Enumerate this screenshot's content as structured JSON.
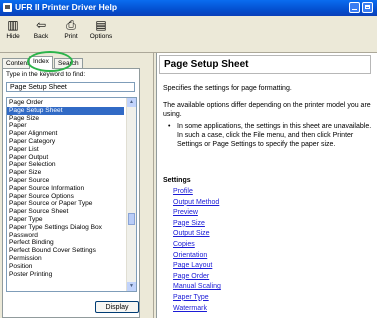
{
  "window": {
    "title": "UFR II Printer Driver Help",
    "min_icon": "minimize-icon",
    "max_icon": "maximize-icon"
  },
  "toolbar": {
    "buttons": [
      {
        "label": "Hide",
        "icon": "hide-icon",
        "glyph": "▥"
      },
      {
        "label": "Back",
        "icon": "back-icon",
        "glyph": "⇦"
      },
      {
        "label": "Print",
        "icon": "print-icon",
        "glyph": "⎙"
      },
      {
        "label": "Options",
        "icon": "options-icon",
        "glyph": "▤"
      }
    ]
  },
  "left": {
    "tabs": [
      "Contents",
      "Index",
      "Search"
    ],
    "active_tab": "Index",
    "prompt": "Type in the keyword to find:",
    "search_value": "Page Setup Sheet",
    "items": [
      "Page Order",
      "Page Setup Sheet",
      "Page Size",
      "Paper",
      "Paper Alignment",
      "Paper Category",
      "Paper List",
      "Paper Output",
      "Paper Selection",
      "Paper Size",
      "Paper Source",
      "Paper Source Information",
      "Paper Source Options",
      "Paper Source or Paper Type",
      "Paper Source Sheet",
      "Paper Type",
      "Paper Type Settings Dialog Box",
      "Password",
      "Perfect Binding",
      "Perfect Bound Cover Settings",
      "Permission",
      "Position",
      "Poster Printing"
    ],
    "selected_item": "Page Setup Sheet",
    "display_button": "Display"
  },
  "content": {
    "heading": "Page Setup Sheet",
    "para1": "Specifies the settings for page formatting.",
    "para2": "The available options differ depending on the printer model you are using.",
    "bullet": "•",
    "note": "In some applications, the settings in this sheet are unavailable. In such a case, click the File menu, and then click Printer Settings or Page Settings to specify the paper size.",
    "settings_title": "Settings",
    "links": [
      "Profile",
      "Output Method",
      "Preview",
      "Page Size",
      "Output Size",
      "Copies",
      "Orientation",
      "Page Layout",
      "Page Order",
      "Manual Scaling",
      "Paper Type",
      "Watermark"
    ]
  },
  "colors": {
    "titlebar": "#0450d0",
    "selection": "#316ac5",
    "highlight_circle": "#2bb34a",
    "link": "#1b1bd6"
  }
}
